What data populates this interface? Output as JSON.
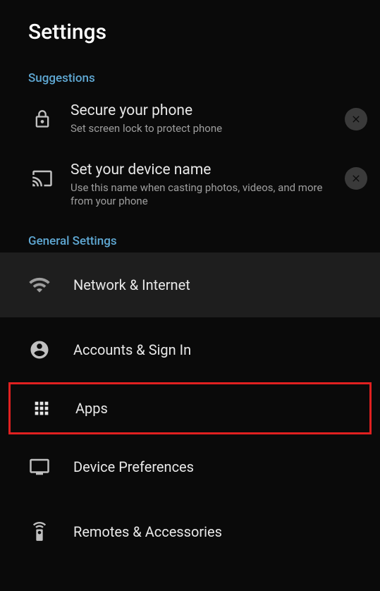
{
  "header": {
    "title": "Settings"
  },
  "sections": {
    "suggestions": {
      "header": "Suggestions",
      "items": [
        {
          "title": "Secure your phone",
          "subtitle": "Set screen lock to protect phone"
        },
        {
          "title": "Set your device name",
          "subtitle": "Use this name when casting photos, videos, and more from your phone"
        }
      ]
    },
    "general": {
      "header": "General Settings",
      "items": [
        {
          "label": "Network & Internet"
        },
        {
          "label": "Accounts & Sign In"
        },
        {
          "label": "Apps"
        },
        {
          "label": "Device Preferences"
        },
        {
          "label": "Remotes & Accessories"
        }
      ]
    }
  }
}
